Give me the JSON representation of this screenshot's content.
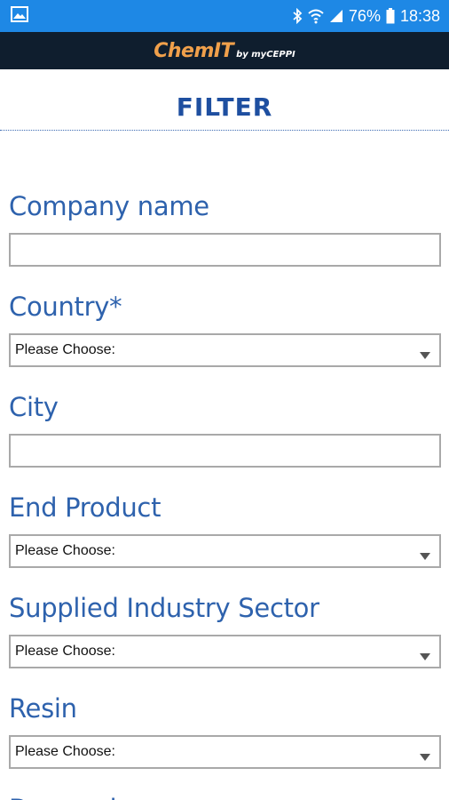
{
  "status_bar": {
    "battery": "76%",
    "time": "18:38",
    "icons": [
      "image-icon",
      "bluetooth-icon",
      "wifi-icon",
      "signal-icon",
      "battery-icon"
    ]
  },
  "header": {
    "logo_main": "ChemIT",
    "logo_sub": "by myCEPPI"
  },
  "page": {
    "title": "FILTER"
  },
  "form": {
    "company_name": {
      "label": "Company name",
      "value": ""
    },
    "country": {
      "label": "Country*",
      "selected": "Please Choose:"
    },
    "city": {
      "label": "City",
      "value": ""
    },
    "end_product": {
      "label": "End Product",
      "selected": "Please Choose:"
    },
    "supplied_industry_sector": {
      "label": "Supplied Industry Sector",
      "selected": "Please Choose:"
    },
    "resin": {
      "label": "Resin",
      "selected": "Please Choose:"
    },
    "next_label_partial": "Demand"
  },
  "colors": {
    "status_bar": "#1e88e5",
    "header_bg": "#0f1e2e",
    "logo_orange": "#f0a04b",
    "title_blue": "#1e4fa0",
    "label_blue": "#2e62ad",
    "input_border": "#a9a9a9"
  }
}
